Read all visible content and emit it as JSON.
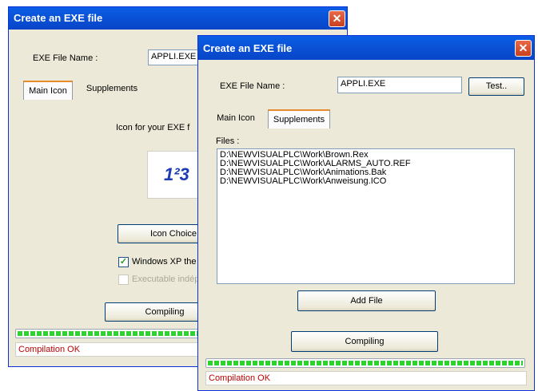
{
  "back_window": {
    "title": "Create an EXE file",
    "exe_label": "EXE File Name :",
    "exe_value": "APPLI.EXE",
    "tabs": [
      {
        "label": "Main Icon"
      },
      {
        "label": "Supplements"
      }
    ],
    "icon_caption": "Icon for your EXE f",
    "icon_glyph": "1²3",
    "icon_choice_label": "Icon Choice",
    "checkbox_xp_label": "Windows XP the",
    "checkbox_exe_label": "Executable indép",
    "compiling_label": "Compiling",
    "status": "Compilation OK"
  },
  "front_window": {
    "title": "Create an EXE file",
    "exe_label": "EXE File Name :",
    "exe_value": "APPLI.EXE",
    "test_label": "Test..",
    "tabs": [
      {
        "label": "Main Icon"
      },
      {
        "label": "Supplements"
      }
    ],
    "files_label": "Files :",
    "files": [
      "D:\\NEWVISUALPLC\\Work\\Brown.Rex",
      "D:\\NEWVISUALPLC\\Work\\ALARMS_AUTO.REF",
      "D:\\NEWVISUALPLC\\Work\\Animations.Bak",
      "D:\\NEWVISUALPLC\\Work\\Anweisung.ICO"
    ],
    "add_file_label": "Add File",
    "compiling_label": "Compiling",
    "status": "Compilation OK"
  },
  "close_glyph": "✕",
  "colors": {
    "titlebar": "#0a53d8",
    "status_text": "#c00000",
    "progress": "#2ed22e"
  }
}
